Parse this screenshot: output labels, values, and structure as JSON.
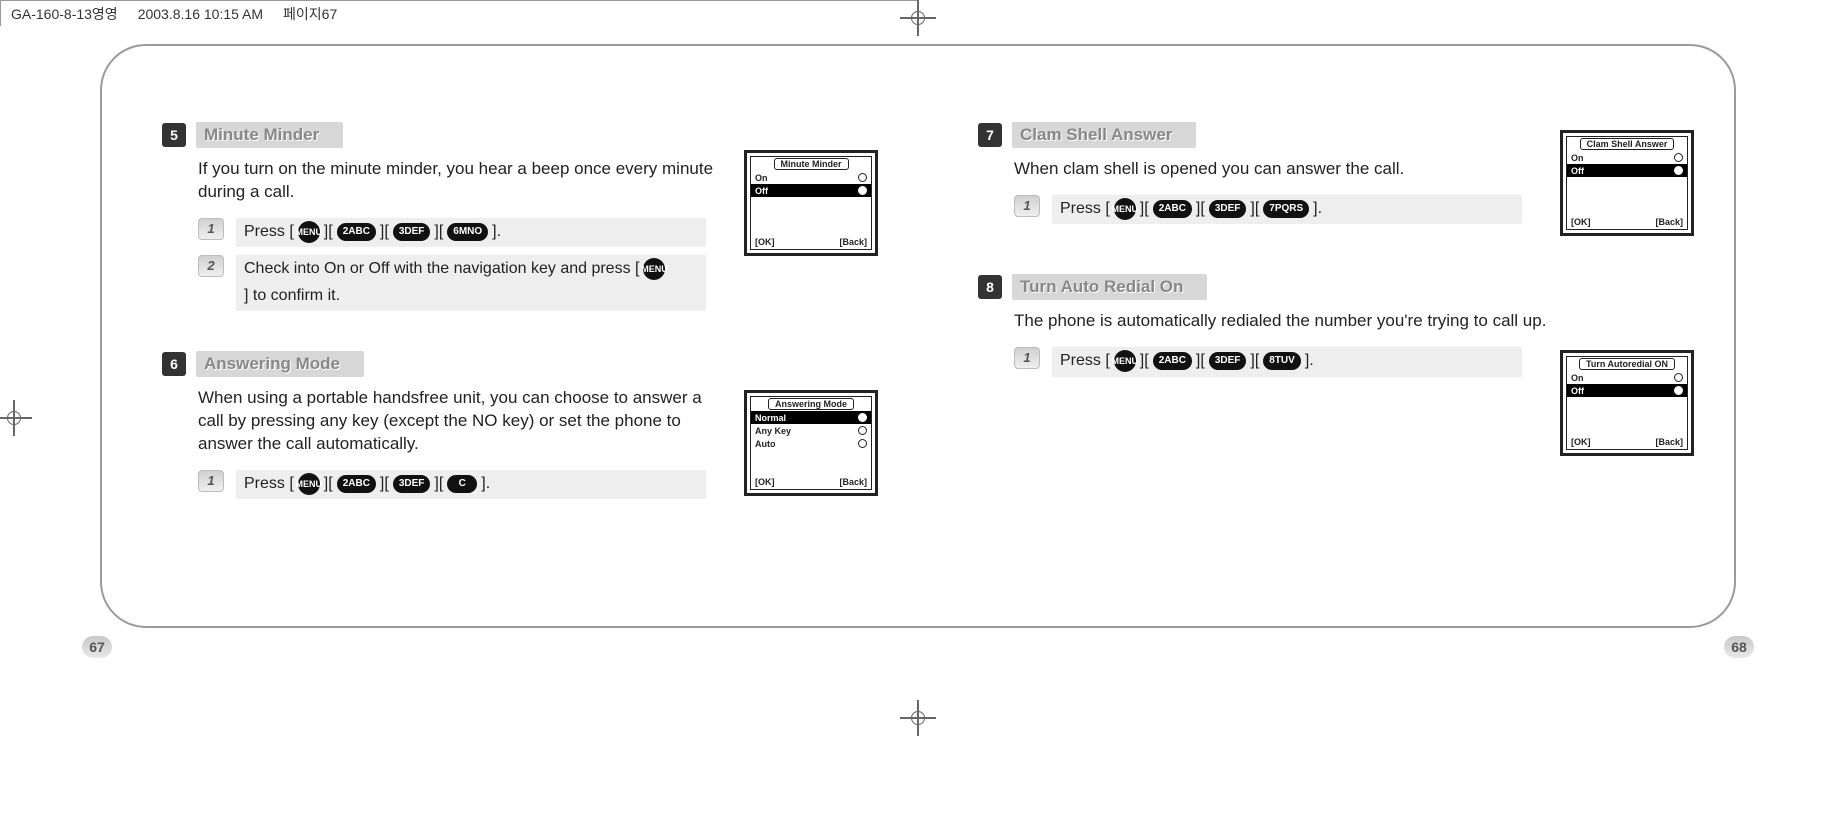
{
  "header": {
    "file": "GA-160-8-13영영",
    "date": "2003.8.16 10:15 AM",
    "page_marker": "페이지67"
  },
  "page_numbers": {
    "left": "67",
    "right": "68"
  },
  "sections": {
    "s5": {
      "num": "5",
      "title": "Minute Minder",
      "desc": "If you turn on the minute minder, you hear a beep once every minute during a call.",
      "step1": {
        "num": "1",
        "prefix": "Press [",
        "k1": "MENU",
        "b1": "][",
        "k2": "2ABC",
        "b2": "][",
        "k3": "3DEF",
        "b3": "][",
        "k4": "6MNO",
        "suffix": "]."
      },
      "step2": {
        "num": "2",
        "t1": "Check into On or Off with the navigation key and press [",
        "k": "MENU",
        "t2": "] to confirm it."
      },
      "screen": {
        "title": "Minute Minder",
        "opt1": "On",
        "opt2": "Off",
        "ok": "[OK]",
        "back": "[Back]"
      }
    },
    "s6": {
      "num": "6",
      "title": "Answering Mode",
      "desc": "When using a portable handsfree unit, you can choose to answer a call by pressing any key (except the NO key) or set the phone to answer the call automatically.",
      "step1": {
        "num": "1",
        "prefix": "Press [",
        "k1": "MENU",
        "b1": "][",
        "k2": "2ABC",
        "b2": "][",
        "k3": "3DEF",
        "b3": "][",
        "k4": "C",
        "suffix": "]."
      },
      "screen": {
        "title": "Answering Mode",
        "opt1": "Normal",
        "opt2": "Any Key",
        "opt3": "Auto",
        "ok": "[OK]",
        "back": "[Back]"
      }
    },
    "s7": {
      "num": "7",
      "title": "Clam Shell Answer",
      "desc": "When clam shell is opened you can answer the call.",
      "step1": {
        "num": "1",
        "prefix": "Press [",
        "k1": "MENU",
        "b1": "][",
        "k2": "2ABC",
        "b2": "][",
        "k3": "3DEF",
        "b3": "][",
        "k4": "7PQRS",
        "suffix": "]."
      },
      "screen": {
        "title": "Clam Shell Answer",
        "opt1": "On",
        "opt2": "Off",
        "ok": "[OK]",
        "back": "[Back]"
      }
    },
    "s8": {
      "num": "8",
      "title": "Turn Auto Redial On",
      "desc": "The phone is automatically redialed the number you're trying to call up.",
      "step1": {
        "num": "1",
        "prefix": "Press [",
        "k1": "MENU",
        "b1": "][",
        "k2": "2ABC",
        "b2": "][",
        "k3": "3DEF",
        "b3": "][",
        "k4": "8TUV",
        "suffix": "]."
      },
      "screen": {
        "title": "Turn Autoredial ON",
        "opt1": "On",
        "opt2": "Off",
        "ok": "[OK]",
        "back": "[Back]"
      }
    }
  }
}
